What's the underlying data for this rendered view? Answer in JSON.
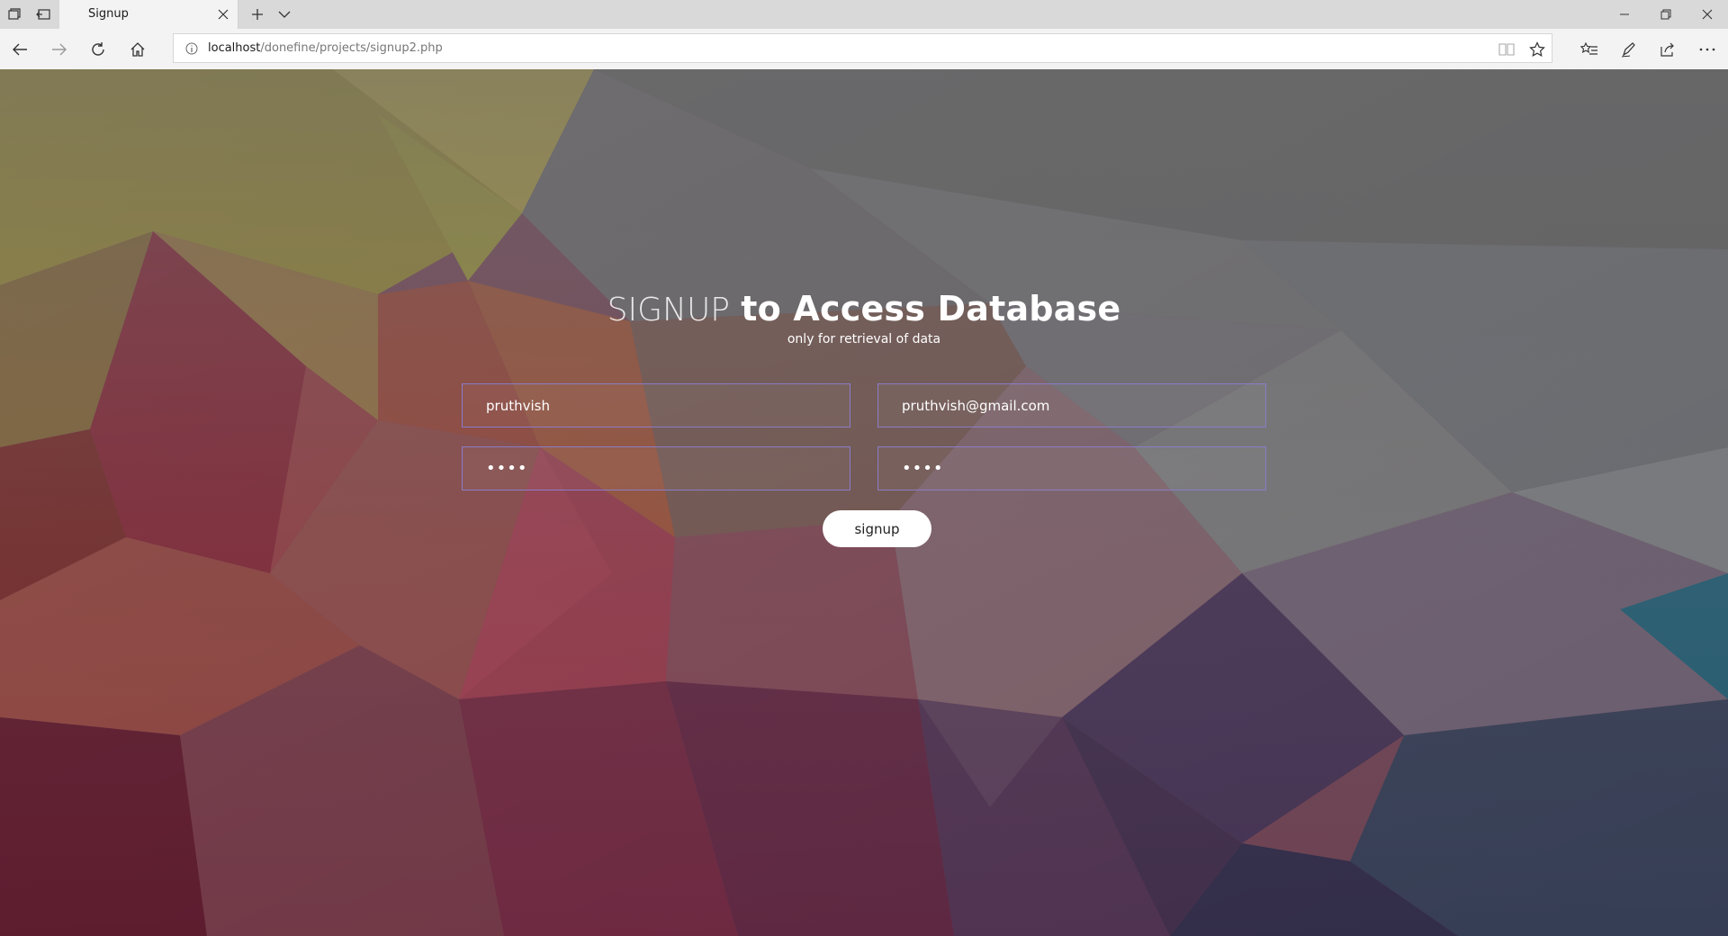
{
  "browser": {
    "tab_title": "Signup",
    "url_host": "localhost",
    "url_path": "/donefine/projects/signup2.php"
  },
  "page": {
    "heading_light": "SIGNUP",
    "heading_bold": "to Access Database",
    "subheading": "only for retrieval of data",
    "username_value": "pruthvish",
    "email_value": "pruthvish@gmail.com",
    "password_value": "abcd",
    "confirm_password_value": "abcd",
    "signup_label": "signup"
  },
  "colors": {
    "field_border": "#8a7cc8",
    "button_bg": "#ffffff"
  },
  "icons": [
    "tabs-aside-icon",
    "restore-tabs-icon",
    "close-icon",
    "plus-icon",
    "chevron-down-icon",
    "back-arrow-icon",
    "forward-arrow-icon",
    "refresh-icon",
    "home-icon",
    "info-icon",
    "reading-view-icon",
    "star-icon",
    "favorites-icon",
    "pen-icon",
    "share-icon",
    "more-icon",
    "minimize-icon",
    "maximize-icon"
  ]
}
